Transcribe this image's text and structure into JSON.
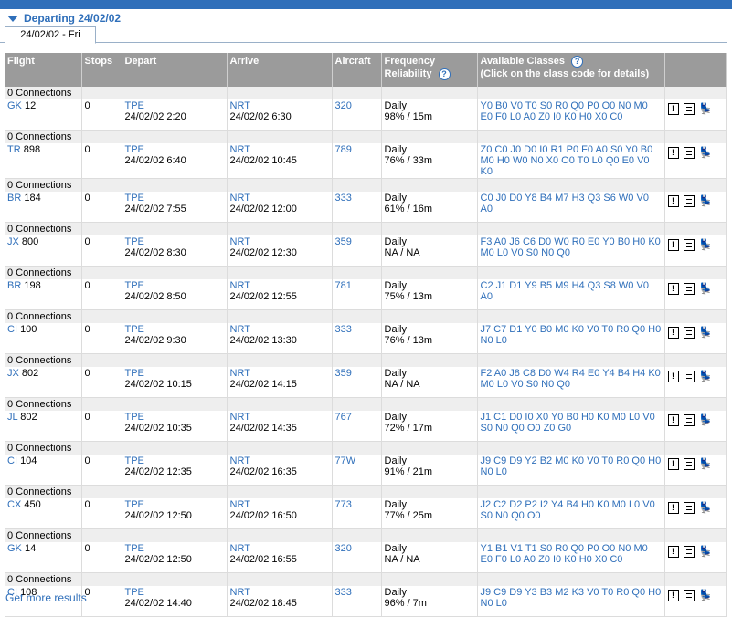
{
  "header": {
    "title": "Departing 24/02/02"
  },
  "tab": {
    "label": "24/02/02 - Fri"
  },
  "columns": {
    "flight": "Flight",
    "stops": "Stops",
    "depart": "Depart",
    "arrive": "Arrive",
    "aircraft": "Aircraft",
    "frequency": "Frequency",
    "reliability": "Reliability",
    "classes": "Available Classes",
    "classes_hint": "(Click on the class code for details)"
  },
  "flights": [
    {
      "connections": "0 Connections",
      "airline": "GK",
      "number": "12",
      "stops": "0",
      "dep_code": "TPE",
      "dep_time": "24/02/02 2:20",
      "arr_code": "NRT",
      "arr_time": "24/02/02 6:30",
      "aircraft": "320",
      "frequency": "Daily",
      "reliability": "98% / 15m",
      "classes": "Y0 B0 V0 T0 S0 R0 Q0 P0 O0 N0 M0 E0 F0 L0 A0 Z0 I0 K0 H0 X0 C0"
    },
    {
      "connections": "0 Connections",
      "airline": "TR",
      "number": "898",
      "stops": "0",
      "dep_code": "TPE",
      "dep_time": "24/02/02 6:40",
      "arr_code": "NRT",
      "arr_time": "24/02/02 10:45",
      "aircraft": "789",
      "frequency": "Daily",
      "reliability": "76% / 33m",
      "classes": "Z0 C0 J0 D0 I0 R1 P0 F0 A0 S0 Y0 B0 M0 H0 W0 N0 X0 O0 T0 L0 Q0 E0 V0 K0"
    },
    {
      "connections": "0 Connections",
      "airline": "BR",
      "number": "184",
      "stops": "0",
      "dep_code": "TPE",
      "dep_time": "24/02/02 7:55",
      "arr_code": "NRT",
      "arr_time": "24/02/02 12:00",
      "aircraft": "333",
      "frequency": "Daily",
      "reliability": "61% / 16m",
      "classes": "C0 J0 D0 Y8 B4 M7 H3 Q3 S6 W0 V0 A0"
    },
    {
      "connections": "0 Connections",
      "airline": "JX",
      "number": "800",
      "stops": "0",
      "dep_code": "TPE",
      "dep_time": "24/02/02 8:30",
      "arr_code": "NRT",
      "arr_time": "24/02/02 12:30",
      "aircraft": "359",
      "frequency": "Daily",
      "reliability": "NA / NA",
      "classes": "F3 A0 J6 C6 D0 W0 R0 E0 Y0 B0 H0 K0 M0 L0 V0 S0 N0 Q0"
    },
    {
      "connections": "0 Connections",
      "airline": "BR",
      "number": "198",
      "stops": "0",
      "dep_code": "TPE",
      "dep_time": "24/02/02 8:50",
      "arr_code": "NRT",
      "arr_time": "24/02/02 12:55",
      "aircraft": "781",
      "frequency": "Daily",
      "reliability": "75% / 13m",
      "classes": "C2 J1 D1 Y9 B5 M9 H4 Q3 S8 W0 V0 A0"
    },
    {
      "connections": "0 Connections",
      "airline": "CI",
      "number": "100",
      "stops": "0",
      "dep_code": "TPE",
      "dep_time": "24/02/02 9:30",
      "arr_code": "NRT",
      "arr_time": "24/02/02 13:30",
      "aircraft": "333",
      "frequency": "Daily",
      "reliability": "76% / 13m",
      "classes": "J7 C7 D1 Y0 B0 M0 K0 V0 T0 R0 Q0 H0 N0 L0"
    },
    {
      "connections": "0 Connections",
      "airline": "JX",
      "number": "802",
      "stops": "0",
      "dep_code": "TPE",
      "dep_time": "24/02/02 10:15",
      "arr_code": "NRT",
      "arr_time": "24/02/02 14:15",
      "aircraft": "359",
      "frequency": "Daily",
      "reliability": "NA / NA",
      "classes": "F2 A0 J8 C8 D0 W4 R4 E0 Y4 B4 H4 K0 M0 L0 V0 S0 N0 Q0"
    },
    {
      "connections": "0 Connections",
      "airline": "JL",
      "number": "802",
      "stops": "0",
      "dep_code": "TPE",
      "dep_time": "24/02/02 10:35",
      "arr_code": "NRT",
      "arr_time": "24/02/02 14:35",
      "aircraft": "767",
      "frequency": "Daily",
      "reliability": "72% / 17m",
      "classes": "J1 C1 D0 I0 X0 Y0 B0 H0 K0 M0 L0 V0 S0 N0 Q0 O0 Z0 G0"
    },
    {
      "connections": "0 Connections",
      "airline": "CI",
      "number": "104",
      "stops": "0",
      "dep_code": "TPE",
      "dep_time": "24/02/02 12:35",
      "arr_code": "NRT",
      "arr_time": "24/02/02 16:35",
      "aircraft": "77W",
      "frequency": "Daily",
      "reliability": "91% / 21m",
      "classes": "J9 C9 D9 Y2 B2 M0 K0 V0 T0 R0 Q0 H0 N0 L0"
    },
    {
      "connections": "0 Connections",
      "airline": "CX",
      "number": "450",
      "stops": "0",
      "dep_code": "TPE",
      "dep_time": "24/02/02 12:50",
      "arr_code": "NRT",
      "arr_time": "24/02/02 16:50",
      "aircraft": "773",
      "frequency": "Daily",
      "reliability": "77% / 25m",
      "classes": "J2 C2 D2 P2 I2 Y4 B4 H0 K0 M0 L0 V0 S0 N0 Q0 O0"
    },
    {
      "connections": "0 Connections",
      "airline": "GK",
      "number": "14",
      "stops": "0",
      "dep_code": "TPE",
      "dep_time": "24/02/02 12:50",
      "arr_code": "NRT",
      "arr_time": "24/02/02 16:55",
      "aircraft": "320",
      "frequency": "Daily",
      "reliability": "NA / NA",
      "classes": "Y1 B1 V1 T1 S0 R0 Q0 P0 O0 N0 M0 E0 F0 L0 A0 Z0 I0 K0 H0 X0 C0"
    },
    {
      "connections": "0 Connections",
      "airline": "CI",
      "number": "108",
      "stops": "0",
      "dep_code": "TPE",
      "dep_time": "24/02/02 14:40",
      "arr_code": "NRT",
      "arr_time": "24/02/02 18:45",
      "aircraft": "333",
      "frequency": "Daily",
      "reliability": "96% / 7m",
      "classes": "J9 C9 D9 Y3 B3 M2 K3 V0 T0 R0 Q0 H0 N0 L0"
    }
  ],
  "footer": {
    "more_link": "Get more results"
  },
  "icons": {
    "alert": "exclamation-icon",
    "details": "document-icon",
    "seat": "seat-icon"
  },
  "colors": {
    "accent": "#2f6fba",
    "header_bg": "#9b9b9b",
    "connection_bg": "#eeeeee"
  }
}
